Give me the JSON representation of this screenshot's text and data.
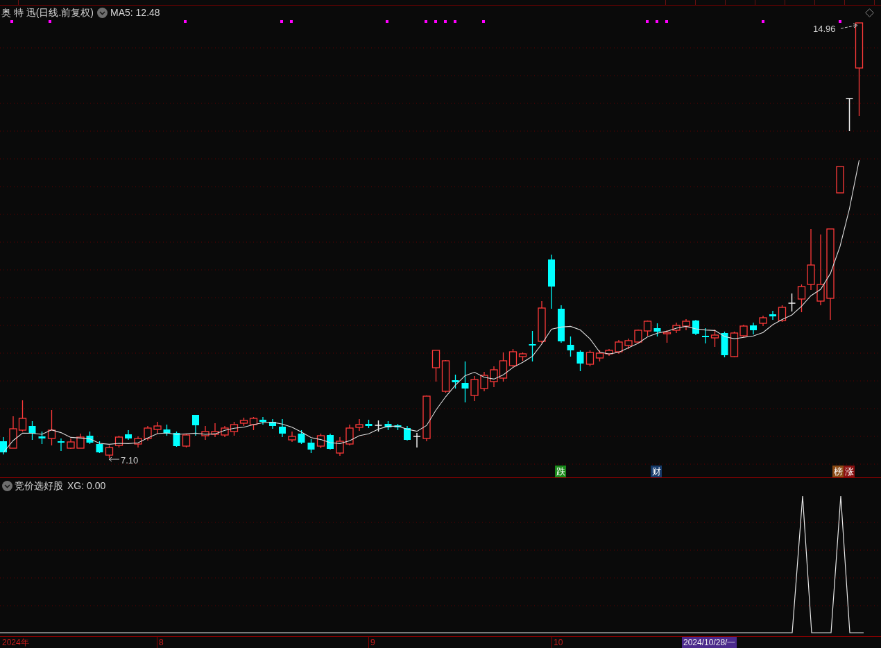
{
  "chart_header": {
    "title": "奥 特 迅(日线.前复权)",
    "indicator": "MA5: 12.48"
  },
  "price_chart": {
    "high_label": "14.96",
    "low_label": "7.10",
    "events": [
      {
        "text": "跌",
        "color": "#1a8a1a"
      },
      {
        "text": "财",
        "color": "#163a6a"
      },
      {
        "text": "榜",
        "color": "#8b4a14"
      },
      {
        "text": "涨",
        "color": "#8a1010"
      }
    ]
  },
  "indicator_panel": {
    "title": "竞价选好股",
    "reading": "XG: 0.00"
  },
  "time_axis": {
    "labels": [
      "2024年",
      "8",
      "9",
      "10"
    ],
    "cursor_date": "2024/10/28/一"
  }
}
